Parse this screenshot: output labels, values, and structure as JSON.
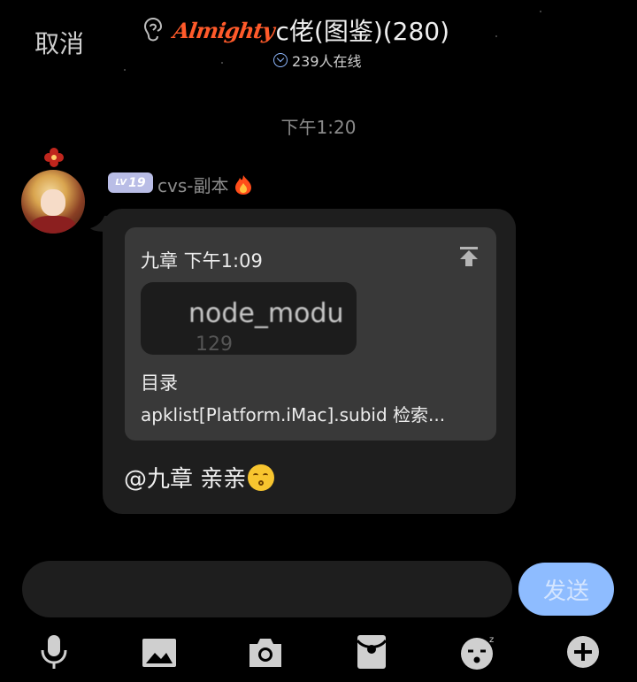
{
  "header": {
    "cancel_label": "取消",
    "brand_logo": "Almighty",
    "title": "c佬(图鉴)(280)",
    "online_count": "239人在线"
  },
  "conversation": {
    "timestamp": "下午1:20",
    "message": {
      "level_prefix": "LV",
      "level_number": "19",
      "sender": "cvs-副本",
      "sender_badge_icon": "fire-icon",
      "quote": {
        "header": "九章 下午1:09",
        "thumbnail_text": "node_modu",
        "thumbnail_subtext": "129",
        "label": "目录",
        "body": "apklist[Platform.iMac].subid 检索..."
      },
      "text": "@九章 亲亲",
      "emoji": "kissing-face-emoji"
    }
  },
  "composer": {
    "input_value": "",
    "send_label": "发送"
  },
  "toolbar": {
    "items": [
      "microphone-icon",
      "image-icon",
      "camera-icon",
      "red-packet-icon",
      "emoji-icon",
      "plus-icon"
    ]
  },
  "colors": {
    "background": "#000000",
    "bubble": "#1e1e1e",
    "quote": "#393939",
    "send_button": "#8ebcff",
    "brand": "#ff5a2a",
    "level_badge": "#b9bde6"
  }
}
